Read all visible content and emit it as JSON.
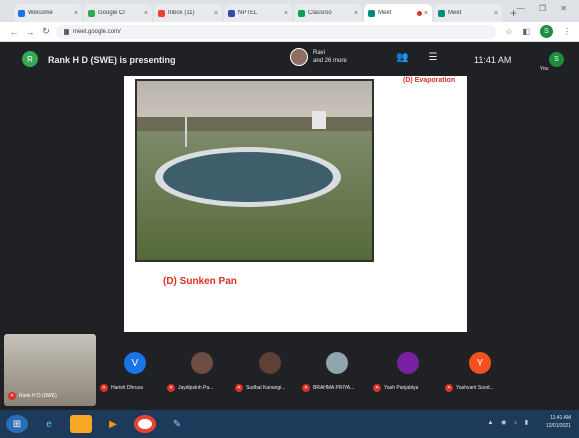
{
  "browser": {
    "tabs": [
      {
        "title": "Welcome",
        "color": "#1a73e8",
        "active": false
      },
      {
        "title": "Google Cl",
        "color": "#34a853",
        "active": false
      },
      {
        "title": "Inbox (11)",
        "color": "#ea4335",
        "active": false
      },
      {
        "title": "NPTEL",
        "color": "#3949ab",
        "active": false
      },
      {
        "title": "Classroo",
        "color": "#0f9d58",
        "active": false
      },
      {
        "title": "Meet",
        "color": "#00897b",
        "active": true
      },
      {
        "title": "Meet",
        "color": "#00897b",
        "active": false
      }
    ],
    "new_tab": "+",
    "window_controls": "— ❐ ✕",
    "url": "meet.google.com/",
    "profile_initial": "S"
  },
  "meet": {
    "presenter_initial": "R",
    "presenting_text": "Rank H D (SWE) is presenting",
    "others_text": "Ravi\nand 26 more",
    "clock": "11:41 AM",
    "self_initial": "S",
    "self_label": "You"
  },
  "slide": {
    "heading": "(D) Evaporation",
    "caption": "(D) Sunken Pan",
    "footer": "",
    "left_footer": ""
  },
  "participants": {
    "self_name": "Rank H D (SWE)",
    "list": [
      {
        "initial": "V",
        "name": "Harish Dhruva",
        "color": "#1a73e8"
      },
      {
        "initial": "",
        "name": "Jaydipsinh Pa...",
        "color": "#6d4c41"
      },
      {
        "initial": "",
        "name": "Sudhal Kanangi...",
        "color": "#5d4037"
      },
      {
        "initial": "",
        "name": "BRAHMA PRIYA...",
        "color": "#90a4ae"
      },
      {
        "initial": "",
        "name": "Yash Panjabiya",
        "color": "#7b1fa2"
      },
      {
        "initial": "Y",
        "name": "Yashvant Sood...",
        "color": "#f4511e"
      }
    ]
  },
  "taskbar": {
    "time": "11:41 AM",
    "date": "12/01/2021"
  }
}
